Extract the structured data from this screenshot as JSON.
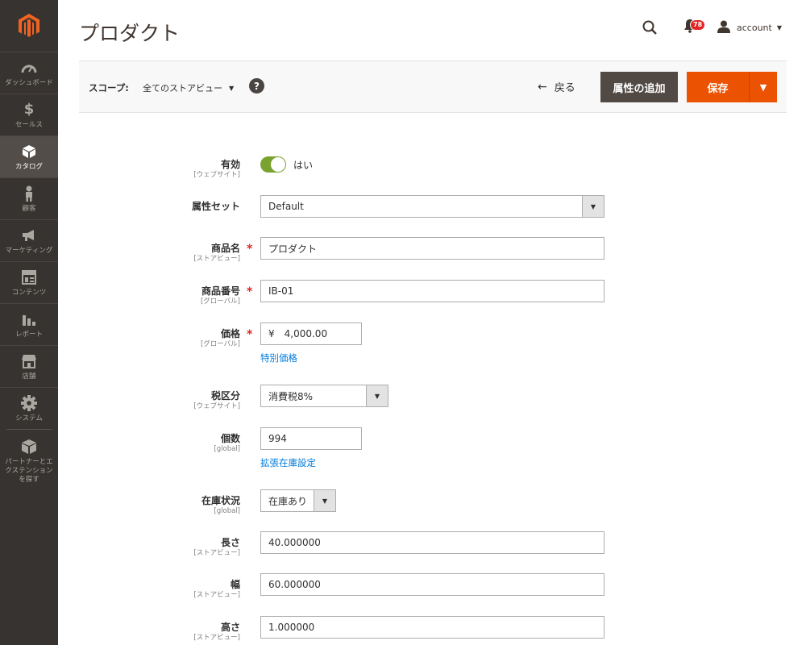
{
  "sidebar": {
    "logo": "magento-logo-icon",
    "items": [
      {
        "label": "ダッシュボード",
        "icon": "dashboard-icon",
        "active": false
      },
      {
        "label": "セールス",
        "icon": "dollar-icon",
        "active": false
      },
      {
        "label": "カタログ",
        "icon": "cube-icon",
        "active": true
      },
      {
        "label": "顧客",
        "icon": "person-icon",
        "active": false
      },
      {
        "label": "マーケティング",
        "icon": "megaphone-icon",
        "active": false
      },
      {
        "label": "コンテンツ",
        "icon": "layout-icon",
        "active": false
      },
      {
        "label": "レポート",
        "icon": "bar-chart-icon",
        "active": false
      },
      {
        "label": "店舗",
        "icon": "store-icon",
        "active": false
      },
      {
        "label": "システム",
        "icon": "gear-icon",
        "active": false
      },
      {
        "label": "パートナーとエクステンションを探す",
        "icon": "boxes-icon",
        "active": false
      }
    ]
  },
  "header": {
    "title": "プロダクト",
    "notification_count": "78",
    "account_label": "account"
  },
  "toolbar": {
    "scope_label": "スコープ:",
    "scope_value": "全てのストアビュー",
    "back_label": "戻る",
    "add_attribute_label": "属性の追加",
    "save_label": "保存"
  },
  "form": {
    "enabled": {
      "label": "有効",
      "scope": "[ウェブサイト]",
      "value": "はい"
    },
    "attribute_set": {
      "label": "属性セット",
      "value": "Default"
    },
    "name": {
      "label": "商品名",
      "scope": "[ストアビュー]",
      "value": "プロダクト"
    },
    "sku": {
      "label": "商品番号",
      "scope": "[グローバル]",
      "value": "IB-01"
    },
    "price": {
      "label": "価格",
      "scope": "[グローバル]",
      "currency": "¥",
      "value": "4,000.00",
      "link": "特別価格"
    },
    "tax_class": {
      "label": "税区分",
      "scope": "[ウェブサイト]",
      "value": "消費税8%"
    },
    "quantity": {
      "label": "個数",
      "scope": "[global]",
      "value": "994",
      "link": "拡張在庫設定"
    },
    "stock_status": {
      "label": "在庫状況",
      "scope": "[global]",
      "value": "在庫あり"
    },
    "length": {
      "label": "長さ",
      "scope": "[ストアビュー]",
      "value": "40.000000"
    },
    "width": {
      "label": "幅",
      "scope": "[ストアビュー]",
      "value": "60.000000"
    },
    "height": {
      "label": "高さ",
      "scope": "[ストアビュー]",
      "value": "1.000000"
    }
  },
  "colors": {
    "sidebar_bg": "#373330",
    "accent": "#eb5202",
    "secondary_button": "#514943",
    "toggle_on": "#79a22e",
    "link": "#007bdb",
    "required": "#e22626"
  }
}
